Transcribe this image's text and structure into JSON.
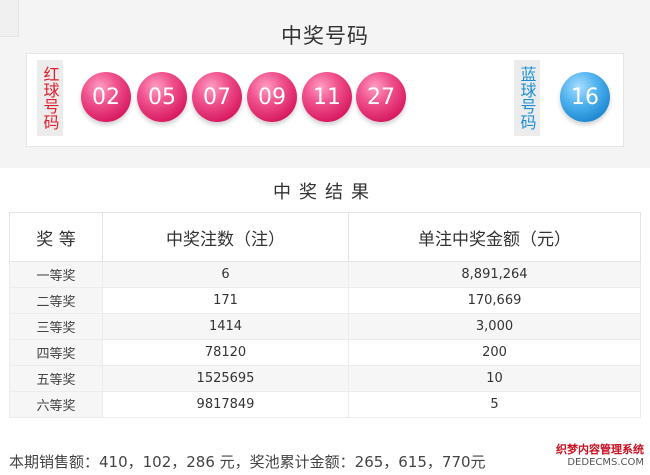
{
  "draw": {
    "title": "中奖号码",
    "red_label": "红球号码",
    "blue_label": "蓝球号码",
    "red_balls": [
      "02",
      "05",
      "07",
      "09",
      "11",
      "27"
    ],
    "blue_balls": [
      "16"
    ],
    "colors": {
      "red_ball": "#e0286e",
      "blue_ball": "#2a95dc",
      "red_label": "#e0202e",
      "blue_label": "#1d8fd6"
    }
  },
  "results": {
    "title": "中奖结果",
    "headers": [
      "奖 等",
      "中奖注数（注）",
      "单注中奖金额（元）"
    ],
    "rows": [
      {
        "level": "一等奖",
        "count": "6",
        "amount": "8,891,264"
      },
      {
        "level": "二等奖",
        "count": "171",
        "amount": "170,669"
      },
      {
        "level": "三等奖",
        "count": "1414",
        "amount": "3,000"
      },
      {
        "level": "四等奖",
        "count": "78120",
        "amount": "200"
      },
      {
        "level": "五等奖",
        "count": "1525695",
        "amount": "10"
      },
      {
        "level": "六等奖",
        "count": "9817849",
        "amount": "5"
      }
    ]
  },
  "footer": {
    "summary": "本期销售额：410，102，286 元，奖池累计金额：265，615，770元"
  },
  "watermark": {
    "line1": "织梦内容管理系统",
    "line2": "DEDECMS.COM"
  }
}
